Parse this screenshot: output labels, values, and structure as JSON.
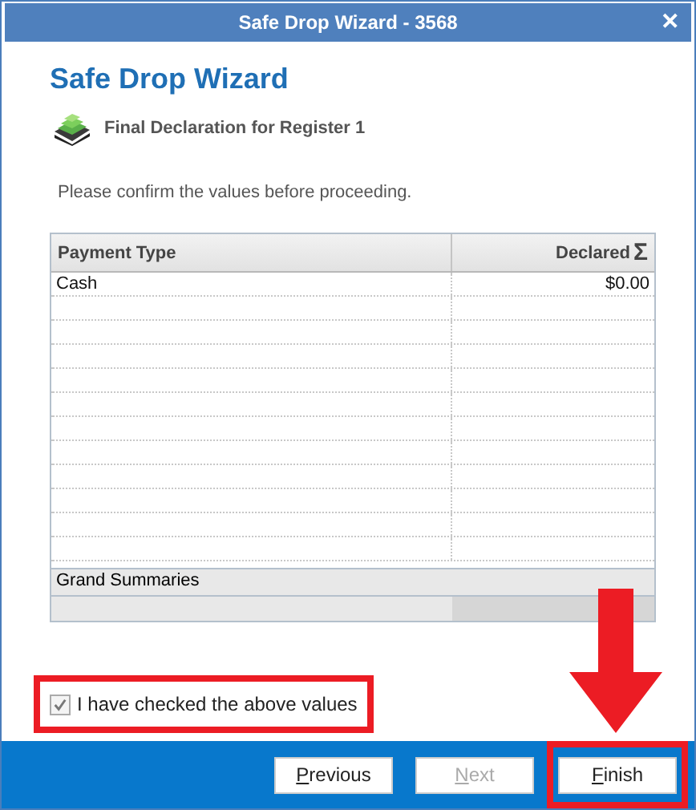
{
  "window": {
    "title": "Safe Drop Wizard - 3568",
    "close": "✕"
  },
  "heading": "Safe Drop Wizard",
  "subheading": "Final Declaration for Register 1",
  "instruction": "Please confirm the values before proceeding.",
  "table": {
    "columns": [
      {
        "label": "Payment Type"
      },
      {
        "label": "Declared",
        "sigma": "Σ"
      }
    ],
    "rows": [
      {
        "cells": [
          "Cash",
          "$0.00"
        ]
      }
    ],
    "summary_label": "Grand Summaries"
  },
  "confirm": {
    "label": "I have checked the above values",
    "checked": true,
    "highlighted": true
  },
  "buttons": [
    {
      "label": "Previous",
      "disabled": false,
      "highlighted": false
    },
    {
      "label": "Next",
      "disabled": true,
      "highlighted": false
    },
    {
      "label": "Finish",
      "disabled": false,
      "highlighted": true
    }
  ]
}
